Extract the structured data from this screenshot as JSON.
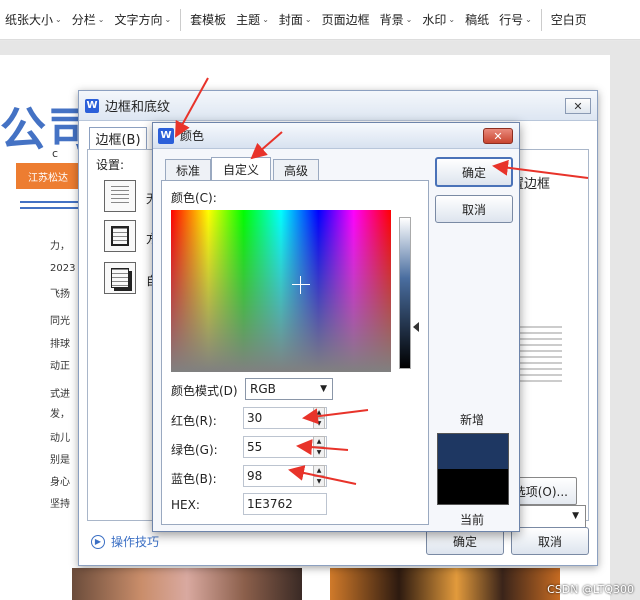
{
  "ribbon": {
    "items": [
      {
        "label": "纸张大小",
        "caret": true
      },
      {
        "label": "分栏",
        "caret": true
      },
      {
        "label": "文字方向",
        "caret": true
      },
      {
        "label": "套模板",
        "caret": false
      },
      {
        "label": "主题",
        "caret": true
      },
      {
        "label": "封面",
        "caret": true
      },
      {
        "label": "页面边框",
        "caret": false
      },
      {
        "label": "背景",
        "caret": true
      },
      {
        "label": "水印",
        "caret": true
      },
      {
        "label": "稿纸",
        "caret": false
      },
      {
        "label": "行号",
        "caret": true
      },
      {
        "label": "空白页",
        "caret": false
      }
    ]
  },
  "document": {
    "title": "公司",
    "c_label": "c",
    "orange_box": "江苏松达",
    "left_lines": [
      "力，",
      "2023",
      "飞扬",
      "同光",
      "排球",
      "动正",
      "式进",
      "发，",
      "动儿",
      "别是",
      "身心",
      "坚持"
    ],
    "watermark": "CSDN @LTQ300"
  },
  "outer_dialog": {
    "title": "边框和底纹",
    "close_glyph": "✕",
    "tab_border": "边框(B)",
    "settings_label": "设置:",
    "setting_none": "无",
    "setting_box": "方",
    "setting_custom": "自",
    "apply_text": "置边框",
    "options_label": "选项(O)...",
    "tips_label": "操作技巧",
    "ok_label": "确定",
    "cancel_label": "取消"
  },
  "color_dialog": {
    "title": "颜色",
    "close_glyph": "✕",
    "tabs": [
      {
        "label": "标准",
        "active": false
      },
      {
        "label": "自定义",
        "active": true
      },
      {
        "label": "高级",
        "active": false
      }
    ],
    "colors_label": "颜色(C):",
    "mode_label": "颜色模式(D)",
    "mode_value": "RGB",
    "red_label": "红色(R):",
    "red_value": "30",
    "green_label": "绿色(G):",
    "green_value": "55",
    "blue_label": "蓝色(B):",
    "blue_value": "98",
    "hex_label": "HEX:",
    "hex_value": "1E3762",
    "ok_label": "确定",
    "cancel_label": "取消",
    "new_label": "新增",
    "current_label": "当前",
    "new_color": "#1E3762",
    "current_color": "#000000"
  },
  "annotation_color": "#e8332a"
}
